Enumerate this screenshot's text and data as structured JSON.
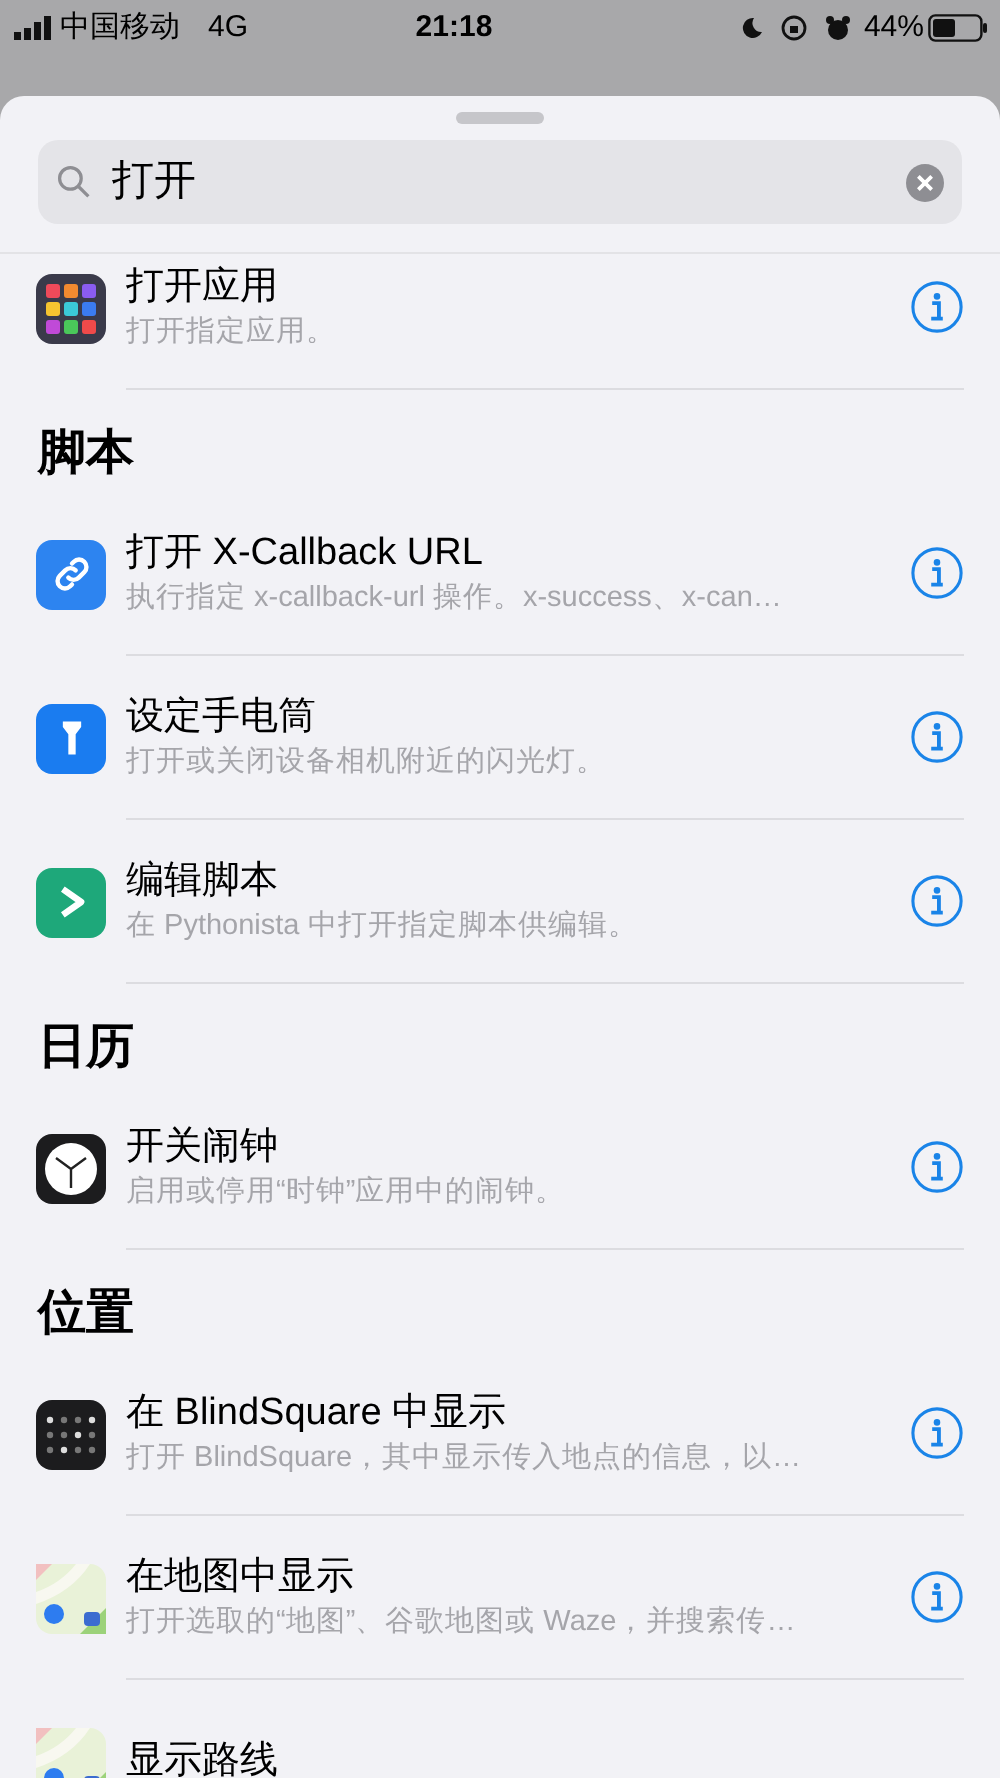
{
  "status_bar": {
    "carrier": "中国移动",
    "network": "4G",
    "time": "21:18",
    "battery": "44%"
  },
  "search": {
    "value": "打开"
  },
  "sections": [
    {
      "items": [
        {
          "kind": "apps",
          "title": "打开应用",
          "subtitle": "打开指定应用。",
          "info_button": true
        }
      ]
    },
    {
      "header": "脚本",
      "items": [
        {
          "kind": "link",
          "title": "打开 X-Callback URL",
          "subtitle": "执行指定 x-callback-url 操作。x-success、x-can…",
          "info_button": true
        },
        {
          "kind": "flashlight",
          "title": "设定手电筒",
          "subtitle": "打开或关闭设备相机附近的闪光灯。",
          "info_button": true
        },
        {
          "kind": "script",
          "title": "编辑脚本",
          "subtitle": "在 Pythonista 中打开指定脚本供编辑。",
          "info_button": true
        }
      ]
    },
    {
      "header": "日历",
      "items": [
        {
          "kind": "clock",
          "title": "开关闹钟",
          "subtitle": "启用或停用“时钟”应用中的闹钟。",
          "info_button": true
        }
      ]
    },
    {
      "header": "位置",
      "items": [
        {
          "kind": "dots",
          "title": "在 BlindSquare 中显示",
          "subtitle": "打开 BlindSquare，其中显示传入地点的信息，以…",
          "info_button": true
        },
        {
          "kind": "map",
          "title": "在地图中显示",
          "subtitle": "打开选取的“地图”、谷歌地图或 Waze，并搜索传…",
          "info_button": true
        },
        {
          "kind": "map",
          "title": "显示路线",
          "info_button": false
        }
      ]
    }
  ]
}
